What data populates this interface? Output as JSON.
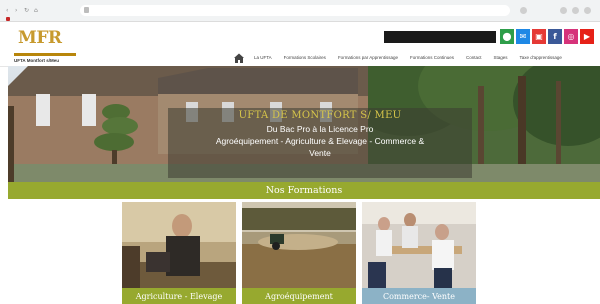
{
  "browser": {
    "tab_label": "",
    "address": "",
    "right_text": ""
  },
  "logo": {
    "title": "MFR",
    "subtitle": "",
    "school_name": "UFTA Montfort s/Meu"
  },
  "header": {
    "visit_button": "",
    "social": [
      {
        "name": "location-icon",
        "color": "#2e9e4a",
        "glyph": "⬤"
      },
      {
        "name": "mail-icon",
        "color": "#1e88e5",
        "glyph": "✉"
      },
      {
        "name": "bag-icon",
        "color": "#e53935",
        "glyph": "▣"
      },
      {
        "name": "facebook-icon",
        "color": "#3b5998",
        "glyph": "f"
      },
      {
        "name": "instagram-icon",
        "color": "#d6337a",
        "glyph": "◎"
      },
      {
        "name": "youtube-icon",
        "color": "#e62117",
        "glyph": "▶"
      }
    ]
  },
  "menu": {
    "items": [
      "La UFTA",
      "Formations Scolaires",
      "Formations par Apprentissage",
      "Formations Continues",
      "Contact",
      "Stages",
      "Taxe d'apprentissage"
    ]
  },
  "hero": {
    "title": "UFTA DE MONTFORT S/ MEU",
    "line1": "Du Bac Pro à la Licence Pro",
    "line2": "Agroéquipement - Agriculture & Elevage - Commerce &",
    "line3": "Vente"
  },
  "section": {
    "title": "Nos Formations"
  },
  "cards": [
    {
      "label": "Agriculture - Elevage",
      "color": "#97a92f"
    },
    {
      "label": "Agroéquipement",
      "color": "#97a92f"
    },
    {
      "label": "Commerce- Vente",
      "color": "#8cb2c6"
    }
  ]
}
